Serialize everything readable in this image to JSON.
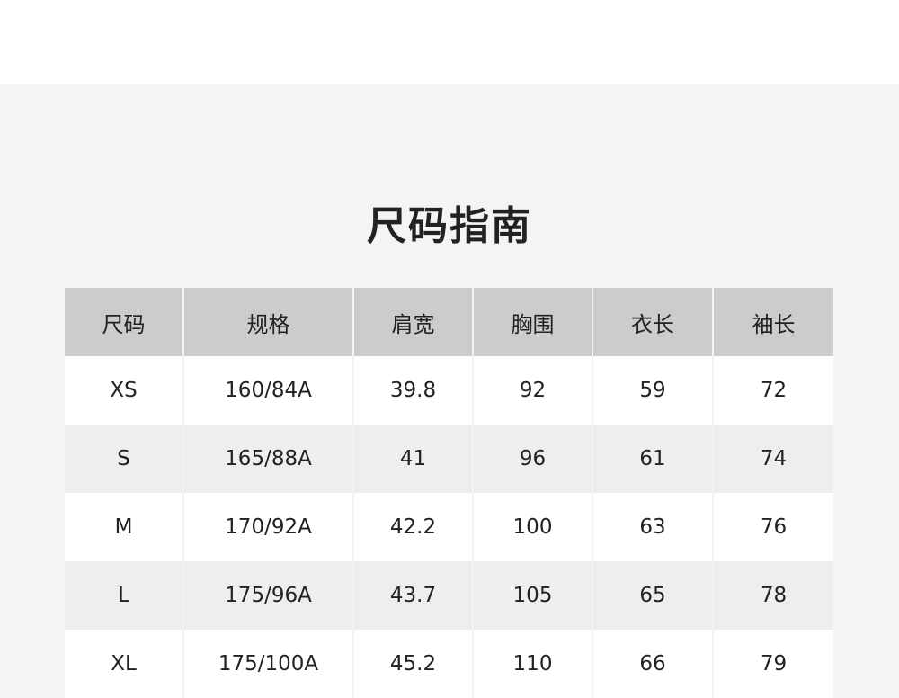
{
  "title": "尺码指南",
  "table": {
    "headers": [
      "尺码",
      "规格",
      "肩宽",
      "胸围",
      "衣长",
      "袖长"
    ],
    "rows": [
      [
        "XS",
        "160/84A",
        "39.8",
        "92",
        "59",
        "72"
      ],
      [
        "S",
        "165/88A",
        "41",
        "96",
        "61",
        "74"
      ],
      [
        "M",
        "170/92A",
        "42.2",
        "100",
        "63",
        "76"
      ],
      [
        "L",
        "175/96A",
        "43.7",
        "105",
        "65",
        "78"
      ],
      [
        "XL",
        "175/100A",
        "45.2",
        "110",
        "66",
        "79"
      ]
    ]
  },
  "colors": {
    "header_bg": "#cccccc",
    "row_odd_bg": "#ffffff",
    "row_even_bg": "#eeeeee",
    "panel_bg": "#f4f4f4"
  }
}
